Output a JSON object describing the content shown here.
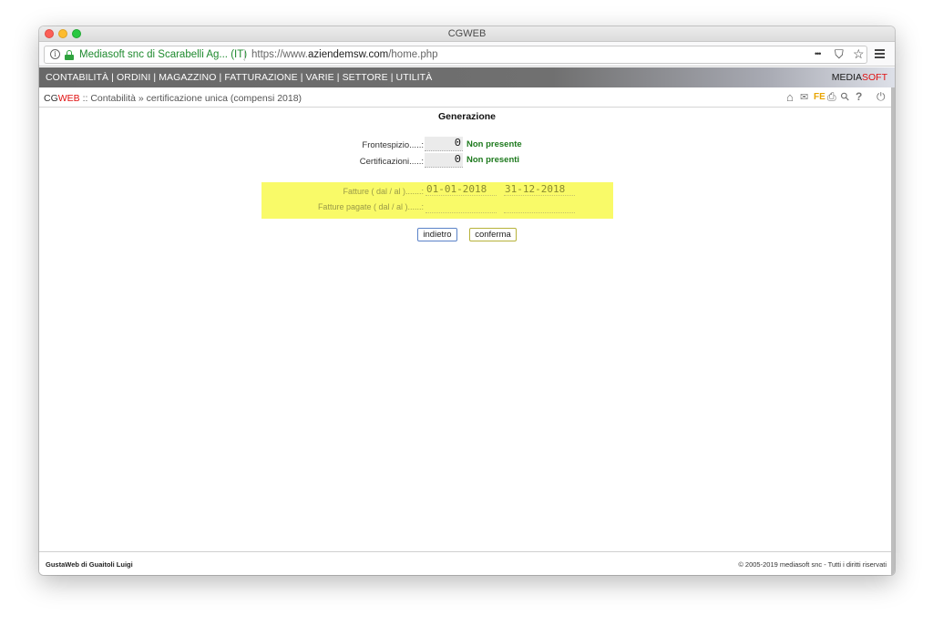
{
  "window": {
    "title": "CGWEB"
  },
  "browser": {
    "site_identity": "Mediasoft snc di Scarabelli Ag... (IT)",
    "url_prefix": "https://www.",
    "url_domain": "aziendemsw.com",
    "url_path": "/home.php",
    "more_glyph": "•••",
    "pocket_glyph": "⛉",
    "bookmark_glyph": "☆"
  },
  "menu": {
    "items": [
      "CONTABILITÀ",
      "ORDINI",
      "MAGAZZINO",
      "FATTURAZIONE",
      "VARIE",
      "SETTORE",
      "UTILITÀ"
    ],
    "separator": "|"
  },
  "brand": {
    "part1": "MEDIA",
    "part2": "SOFT"
  },
  "breadcrumb": {
    "app_part1": "CG",
    "app_part2": "WEB",
    "path": " :: Contabilità » certificazione unica (compensi 2018)"
  },
  "toolbar": {
    "home_glyph": "⌂",
    "mail_glyph": "✉",
    "fe_label": "FE",
    "print_glyph": "⎙",
    "search_glyph": "⚲",
    "help_glyph": "?",
    "power_glyph": "⏻"
  },
  "page": {
    "title": "Generazione"
  },
  "summary": {
    "frontespizio_label": "Frontespizio.....:",
    "frontespizio_value": "0",
    "frontespizio_status": "Non presente",
    "certificazioni_label": "Certificazioni.....:",
    "certificazioni_value": "0",
    "certificazioni_status": "Non presenti"
  },
  "filters": {
    "fatture_label": "Fatture ( dal / al ).......:",
    "fatture_from": "01-01-2018",
    "fatture_to": "31-12-2018",
    "pagate_label": "Fatture pagate ( dal / al )......:",
    "pagate_from": "",
    "pagate_to": ""
  },
  "buttons": {
    "back": "indietro",
    "confirm": "conferma"
  },
  "footer": {
    "left": "GustaWeb di Guaitoli Luigi",
    "right": "© 2005-2019 mediasoft snc - Tutti i diritti riservati"
  },
  "colors": {
    "menubar": "#686868",
    "brand_red": "#e01010",
    "status_green": "#1e7a1e",
    "highlight_yellow": "#f9fa68",
    "lock_green": "#2fa33f"
  }
}
